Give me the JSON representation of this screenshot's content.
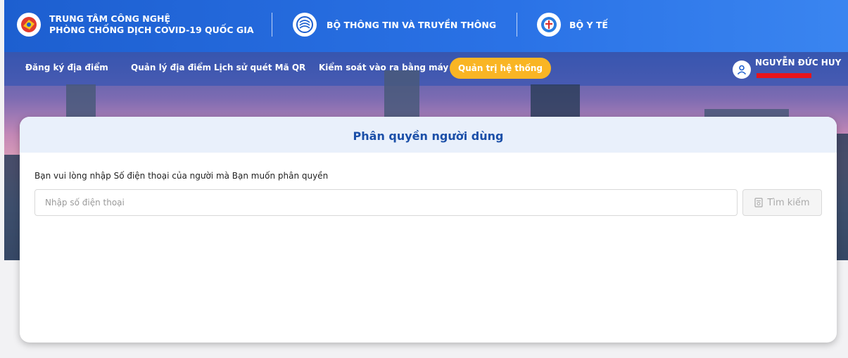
{
  "header": {
    "org1_line1": "TRUNG TÂM CÔNG NGHỆ",
    "org1_line2": "PHÒNG CHỐNG DỊCH COVID-19 QUỐC GIA",
    "org2": "BỘ THÔNG TIN VÀ TRUYỀN THÔNG",
    "org3": "BỘ Y TẾ"
  },
  "nav": {
    "items": [
      "Đăng ký địa điểm",
      "Quản lý địa điểm",
      "Lịch sử quét Mã QR",
      "Kiểm soát vào ra bằng máy"
    ],
    "active": "Quản trị hệ thống",
    "user_name": "NGUYỄN ĐỨC HUY"
  },
  "card": {
    "title": "Phân quyền người dùng",
    "instruction": "Bạn vui lòng nhập Số điện thoại của người mà Bạn muốn phân quyền",
    "phone_placeholder": "Nhập số điện thoại",
    "phone_value": "",
    "search_label": "Tìm kiếm"
  },
  "colors": {
    "header_blue": "#1d5fd0",
    "active_nav": "#f9b524",
    "title_blue": "#1b4fa8",
    "redact": "#e8141b"
  }
}
